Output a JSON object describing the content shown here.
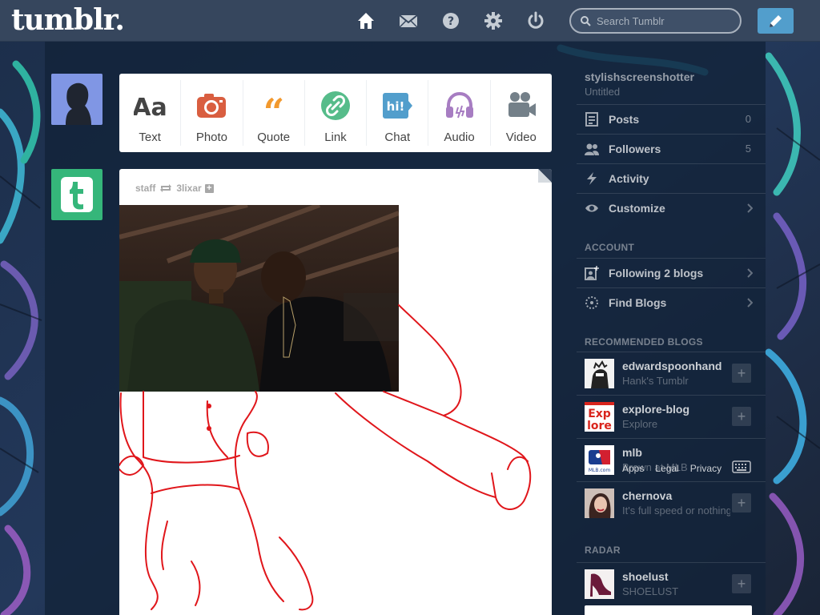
{
  "header": {
    "logo": "tumblr.",
    "search_placeholder": "Search Tumblr",
    "nav_icons": [
      "home-icon",
      "mail-icon",
      "help-icon",
      "gear-icon",
      "power-icon"
    ],
    "compose_icon": "pencil-icon"
  },
  "post_types": [
    {
      "label": "Text",
      "icon": "text-icon",
      "color": "#444444"
    },
    {
      "label": "Photo",
      "icon": "camera-icon",
      "color": "#d95e40"
    },
    {
      "label": "Quote",
      "icon": "quote-icon",
      "color": "#f2992e"
    },
    {
      "label": "Link",
      "icon": "link-icon",
      "color": "#56bc8a"
    },
    {
      "label": "Chat",
      "icon": "chat-icon",
      "color": "#529ecc"
    },
    {
      "label": "Audio",
      "icon": "headphones-icon",
      "color": "#a77dc2"
    },
    {
      "label": "Video",
      "icon": "video-camera-icon",
      "color": "#748089"
    }
  ],
  "post": {
    "author": "staff",
    "reblogged_from": "3lixar"
  },
  "sidebar": {
    "blog_name": "stylishscreenshotter",
    "blog_title": "Untitled",
    "items": [
      {
        "label": "Posts",
        "count": "0",
        "icon": "posts-icon"
      },
      {
        "label": "Followers",
        "count": "5",
        "icon": "followers-icon"
      },
      {
        "label": "Activity",
        "count": "",
        "icon": "activity-icon"
      },
      {
        "label": "Customize",
        "count": "",
        "icon": "eye-icon"
      }
    ],
    "account_heading": "ACCOUNT",
    "account_items": [
      {
        "label": "Following 2 blogs",
        "icon": "following-icon"
      },
      {
        "label": "Find Blogs",
        "icon": "compass-icon"
      }
    ],
    "recommended_heading": "RECOMMENDED BLOGS",
    "recommended": [
      {
        "name": "edwardspoonhand",
        "subtitle": "Hank's Tumblr"
      },
      {
        "name": "explore-blog",
        "subtitle": "Explore"
      },
      {
        "name": "mlb",
        "subtitle": "Brown at MLB"
      },
      {
        "name": "chernova",
        "subtitle": "It's full speed or nothing"
      }
    ],
    "footer_links": [
      "Apps",
      "Legal",
      "Privacy"
    ],
    "radar_heading": "RADAR",
    "radar": {
      "name": "shoelust",
      "subtitle": "SHOELUST"
    }
  },
  "colors": {
    "header_bg": "#36465d",
    "compose_bg": "#529ecc",
    "staff_green": "#35b67a",
    "drawing_red": "#e0161b"
  }
}
